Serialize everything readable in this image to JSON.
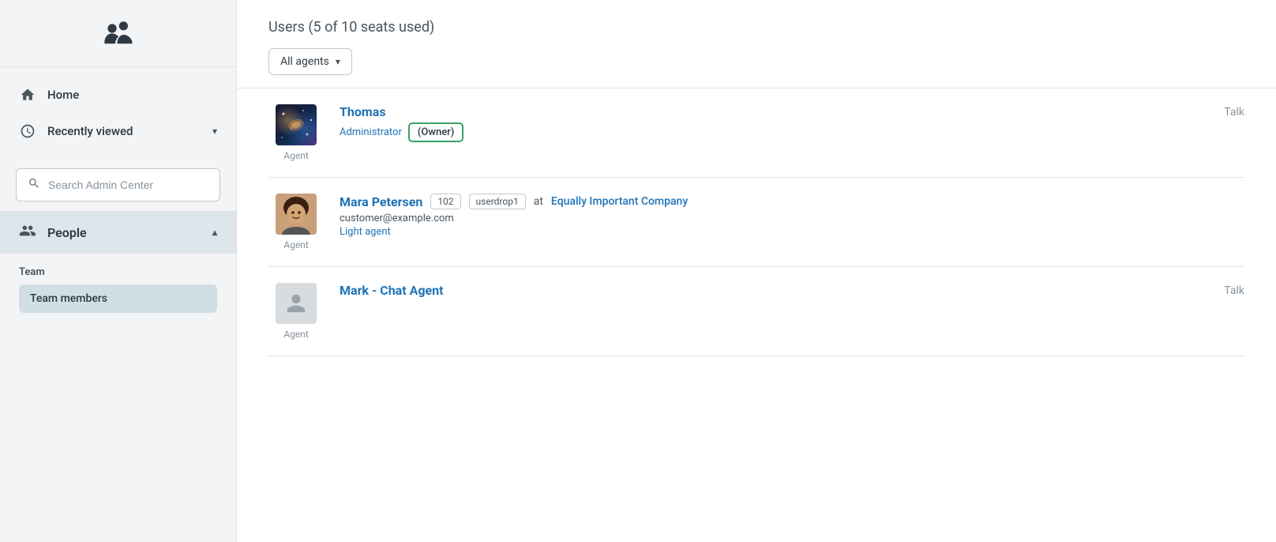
{
  "sidebar": {
    "logo_alt": "Zendesk Logo",
    "nav_items": [
      {
        "id": "home",
        "label": "Home",
        "icon": "home-icon"
      },
      {
        "id": "recently-viewed",
        "label": "Recently viewed",
        "icon": "clock-icon",
        "has_chevron": true,
        "chevron": "chevron-down"
      }
    ],
    "search": {
      "placeholder": "Search Admin Center"
    },
    "people": {
      "label": "People",
      "icon": "people-icon",
      "chevron": "chevron-up"
    },
    "team": {
      "section_label": "Team",
      "items": [
        {
          "id": "team-members",
          "label": "Team members",
          "active": true
        }
      ]
    }
  },
  "main": {
    "page_title": "Users (5 of 10 seats used)",
    "filter": {
      "label": "All agents",
      "chevron": "chevron-down-icon"
    },
    "users": [
      {
        "id": "thomas",
        "name": "Thomas",
        "role_label": "Agent",
        "role": "Administrator",
        "owner_badge": "(Owner)",
        "product": "Talk",
        "has_owner_badge": true
      },
      {
        "id": "mara-petersen",
        "name": "Mara Petersen",
        "badges": [
          "102",
          "userdrop1"
        ],
        "at_text": "at",
        "company": "Equally Important Company",
        "role_label": "Agent",
        "email": "customer@example.com",
        "user_type": "Light agent",
        "product": ""
      },
      {
        "id": "mark-chat-agent",
        "name": "Mark - Chat Agent",
        "role_label": "Agent",
        "product": "Talk"
      }
    ]
  },
  "colors": {
    "accent_blue": "#1f73b7",
    "owner_green": "#38a169",
    "sidebar_bg": "#f3f4f6",
    "active_item_bg": "#d1dfe5",
    "people_bg": "#dde6ea"
  }
}
